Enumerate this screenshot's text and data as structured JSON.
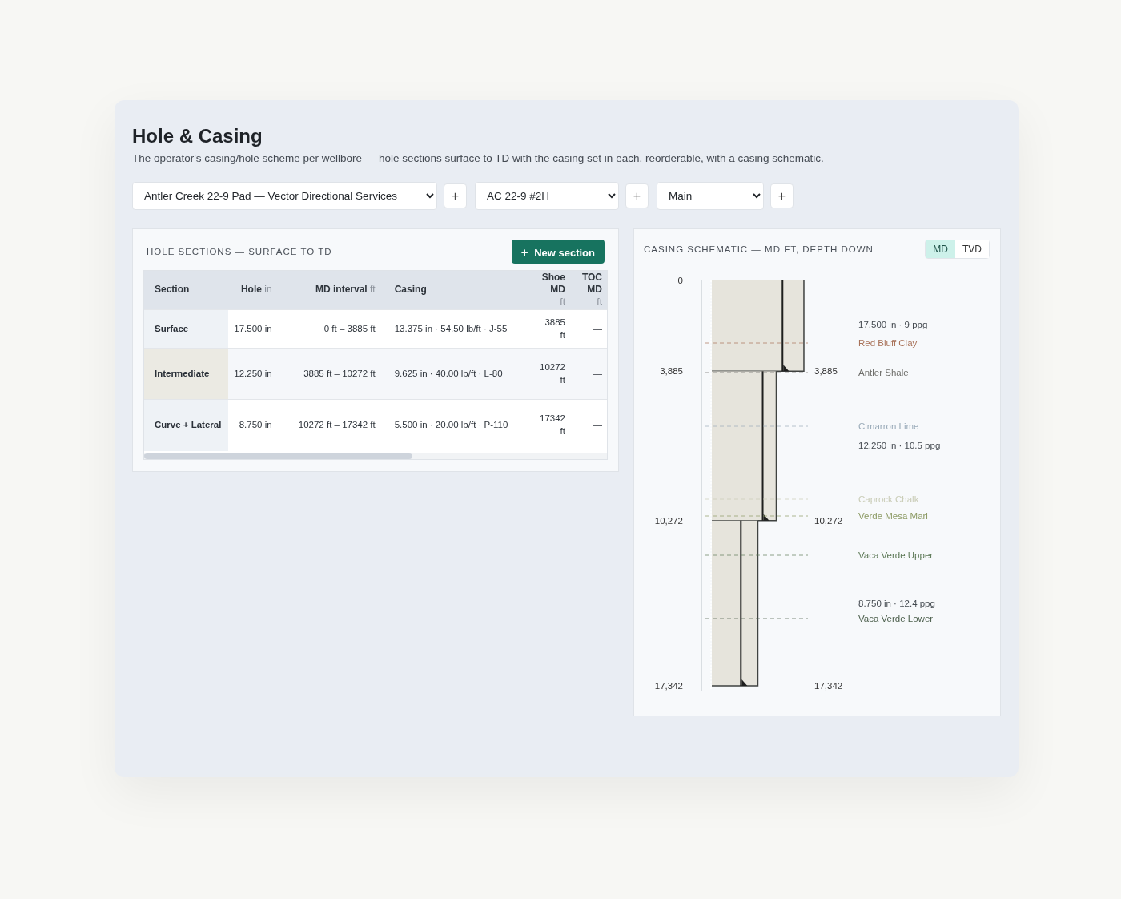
{
  "page": {
    "title": "Hole & Casing",
    "subtitle": "The operator's casing/hole scheme per wellbore — hole sections surface to TD with the casing set in each, reorderable, with a casing schematic."
  },
  "selectors": [
    {
      "value": "Antler Creek 22-9 Pad — Vector Directional Services",
      "add": "+"
    },
    {
      "value": "AC 22-9 #2H",
      "add": "+"
    },
    {
      "value": "Main",
      "add": "+"
    }
  ],
  "sections_panel": {
    "title": "HOLE SECTIONS — SURFACE TO TD",
    "new_button": {
      "icon": "+",
      "label": "New section"
    },
    "columns": [
      {
        "label": "Section"
      },
      {
        "label": "Hole",
        "unit": "in"
      },
      {
        "label": "MD interval",
        "unit": "ft"
      },
      {
        "label": "Casing"
      },
      {
        "label": "Shoe MD",
        "unit": "ft"
      },
      {
        "label": "TOC MD",
        "unit": "ft"
      }
    ],
    "rows": [
      {
        "section": "Surface",
        "hole": "17.500 in",
        "md_interval": "0 ft – 3885 ft",
        "casing": "13.375 in · 54.50 lb/ft · J-55",
        "shoe_md": "3885 ft",
        "toc_md": "—",
        "selected": false
      },
      {
        "section": "Intermediate",
        "hole": "12.250 in",
        "md_interval": "3885 ft – 10272 ft",
        "casing": "9.625 in · 40.00 lb/ft · L-80",
        "shoe_md": "10272 ft",
        "toc_md": "—",
        "selected": true
      },
      {
        "section": "Curve + Lateral",
        "hole": "8.750 in",
        "md_interval": "10272 ft – 17342 ft",
        "casing": "5.500 in · 20.00 lb/ft · P-110",
        "shoe_md": "17342 ft",
        "toc_md": "—",
        "selected": false
      }
    ]
  },
  "schematic_panel": {
    "title": "CASING SCHEMATIC — MD FT, DEPTH DOWN",
    "modes": [
      {
        "label": "MD",
        "selected": true
      },
      {
        "label": "TVD",
        "selected": false
      }
    ],
    "left_depths": [
      "0",
      "3,885",
      "10,272",
      "17,342"
    ],
    "right_depths": [
      "3,885",
      "10,272",
      "17,342"
    ],
    "mud_labels": [
      "17.500 in · 9 ppg",
      "12.250 in · 10.5 ppg",
      "8.750 in · 12.4 ppg"
    ],
    "formations": [
      {
        "name": "Red Bluff Clay",
        "color": "#a9735a"
      },
      {
        "name": "Antler Shale",
        "color": "#6e6e6a"
      },
      {
        "name": "Cimarron Lime",
        "color": "#9aabb9"
      },
      {
        "name": "Caprock Chalk",
        "color": "#c9ccb6"
      },
      {
        "name": "Verde Mesa Marl",
        "color": "#8c9a64"
      },
      {
        "name": "Vaca Verde Upper",
        "color": "#5e7a58"
      },
      {
        "name": "Vaca Verde Lower",
        "color": "#4c5f4c"
      }
    ]
  }
}
